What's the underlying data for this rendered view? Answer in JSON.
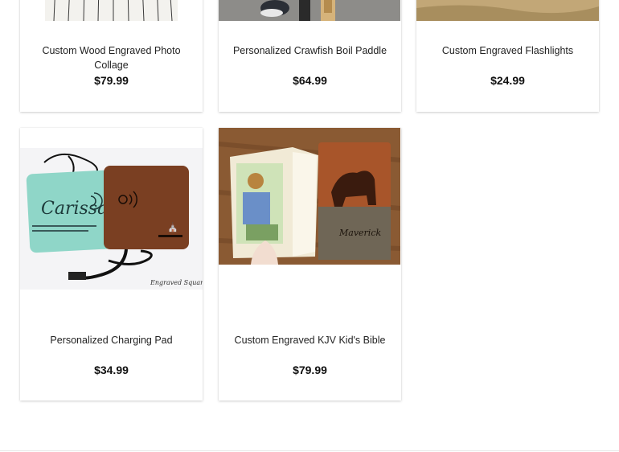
{
  "products": [
    {
      "title": "Custom Wood Engraved Photo Collage",
      "price": "$79.99",
      "image": "wood-photo-collage-image"
    },
    {
      "title": "Personalized Crawfish Boil Paddle",
      "price": "$64.99",
      "image": "crawfish-paddle-image"
    },
    {
      "title": "Custom Engraved Flashlights",
      "price": "$24.99",
      "image": "engraved-flashlight-image"
    },
    {
      "title": "Personalized Charging Pad",
      "price": "$34.99",
      "image": "charging-pad-image",
      "text": {
        "name": "Carissa",
        "signature": "Engraved Square"
      }
    },
    {
      "title": "Custom Engraved KJV Kid's Bible",
      "price": "$79.99",
      "image": "kids-bible-image",
      "text": {
        "name": "Maverick"
      }
    }
  ]
}
